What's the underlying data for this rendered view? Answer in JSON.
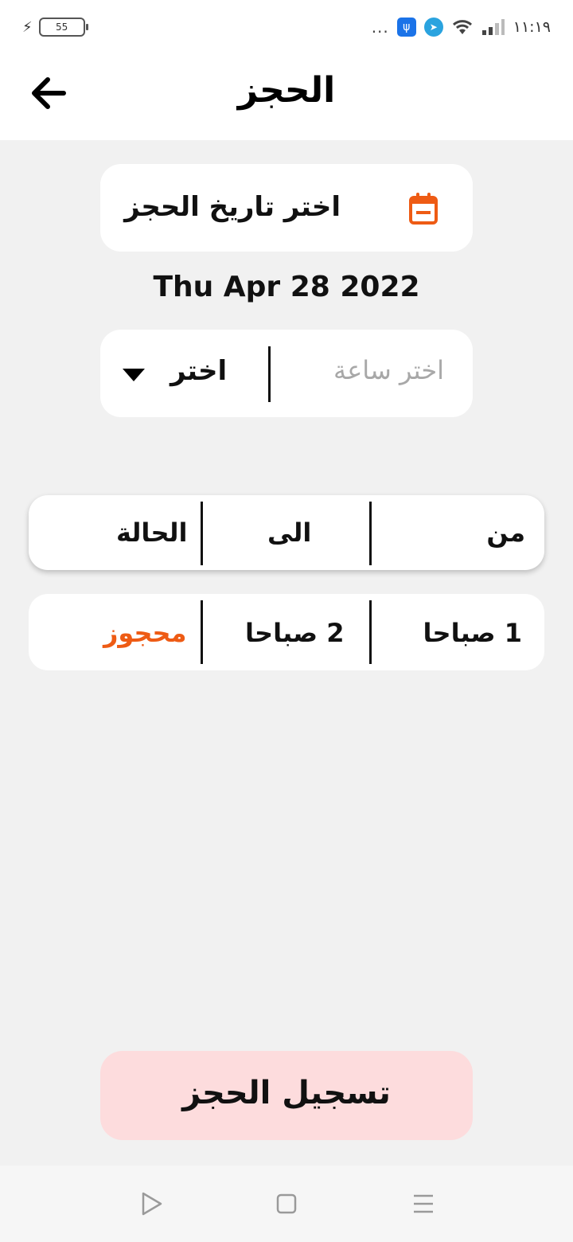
{
  "status_bar": {
    "battery_level": "55",
    "dots": "...",
    "time": "١١:١٩"
  },
  "header": {
    "title": "الحجز",
    "back_icon": "arrow-left-icon"
  },
  "date_picker": {
    "label": "اختر تاريخ الحجز",
    "icon": "calendar-icon",
    "icon_color": "#ee5b14",
    "selected_date": "Thu Apr 28 2022"
  },
  "time_picker": {
    "placeholder": "اختر ساعة",
    "select_label": "اختر",
    "icon": "dropdown-triangle-icon"
  },
  "slots_table": {
    "headers": {
      "from": "من",
      "to": "الى",
      "status": "الحالة"
    },
    "rows": [
      {
        "from": "1 صباحا",
        "to": "2 صباحا",
        "status": "محجوز",
        "status_color": "#ee5b14"
      }
    ]
  },
  "submit_button": {
    "label": "تسجيل الحجز",
    "background": "#fddcdd"
  },
  "nav_bar": {
    "back_icon": "play-back-icon",
    "home_icon": "square-home-icon",
    "menu_icon": "menu-lines-icon"
  }
}
